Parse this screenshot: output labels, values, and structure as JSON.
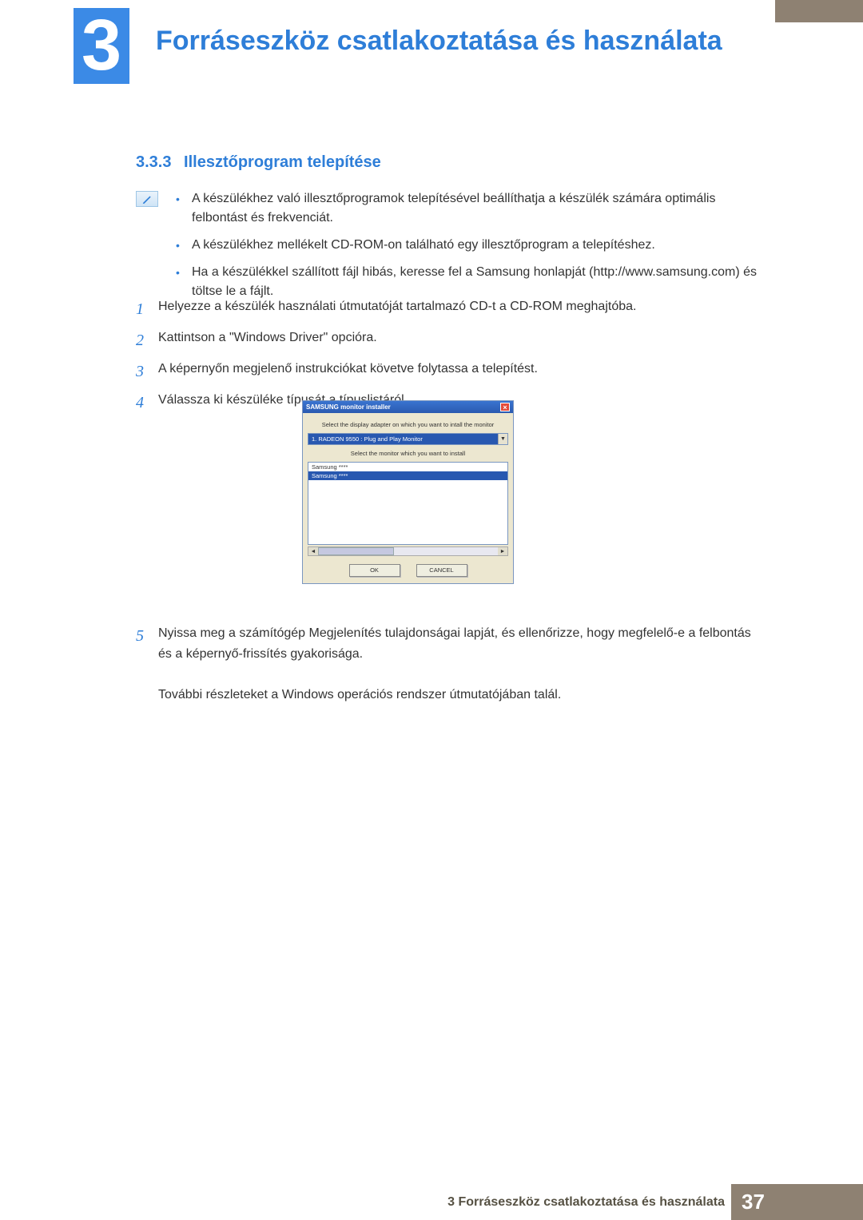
{
  "chapter": {
    "num": "3",
    "title": "Forráseszköz csatlakoztatása és használata"
  },
  "section": {
    "num": "3.3.3",
    "title": "Illesztőprogram telepítése"
  },
  "bullets": [
    "A készülékhez való illesztőprogramok telepítésével beállíthatja a készülék számára optimális felbontást és frekvenciát.",
    "A készülékhez mellékelt CD-ROM-on található egy illesztőprogram a telepítéshez.",
    "Ha a készülékkel szállított fájl hibás, keresse fel a Samsung honlapját (http://www.samsung.com) és töltse le a fájlt."
  ],
  "steps_before": [
    "Helyezze a készülék használati útmutatóját tartalmazó CD-t a CD-ROM meghajtóba.",
    "Kattintson a \"Windows Driver\" opcióra.",
    "A képernyőn megjelenő instrukciókat követve folytassa a telepítést.",
    "Válassza ki készüléke típusát a típuslistáról."
  ],
  "installer": {
    "title": "SAMSUNG monitor installer",
    "label1": "Select the display adapter on which you want to intall the monitor",
    "adapter": "1. RADEON 9550 : Plug and Play Monitor",
    "label2": "Select the monitor which you want to install",
    "list": [
      "Samsung ****",
      "Samsung ****"
    ],
    "ok": "OK",
    "cancel": "CANCEL"
  },
  "step5_num": "5",
  "step5_text": "Nyissa meg a számítógép Megjelenítés tulajdonságai lapját, és ellenőrizze, hogy megfelelő-e a felbontás és a képernyő-frissítés gyakorisága.",
  "step5_extra": "További részleteket a Windows operációs rendszer útmutatójában talál.",
  "footer": {
    "label": "3 Forráseszköz csatlakoztatása és használata",
    "page": "37"
  }
}
